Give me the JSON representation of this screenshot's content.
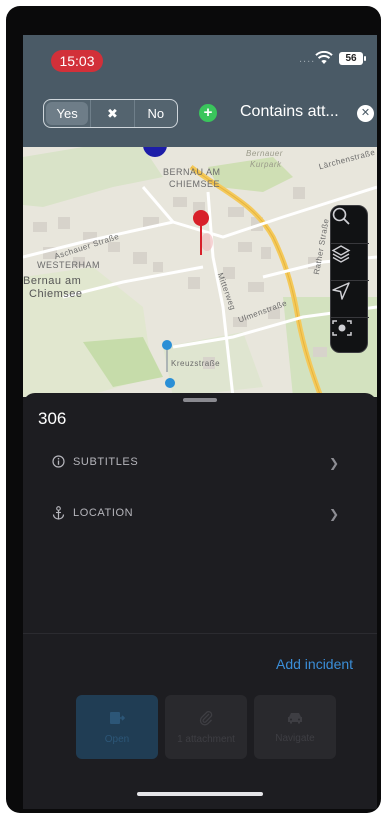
{
  "status_bar": {
    "time": "15:03",
    "signal_dots": "....",
    "battery": "56"
  },
  "filter_bar": {
    "segments": [
      "Yes",
      "✖",
      "No"
    ],
    "selected_segment": "Yes",
    "add_filter_symbol": "+",
    "filter_label": "Contains att...",
    "clear_symbol": "✕"
  },
  "map": {
    "labels": {
      "town_top": "BERNAU AM",
      "town_top_2": "CHIEMSEE",
      "kurpark": "Bernauer",
      "kurpark_2": "Kurpark",
      "larchenstrasse": "Lärchenstraße",
      "aschauer": "Aschauer Straße",
      "westerham": "WESTERHAM",
      "bernau_left": "Bernau am",
      "bernau_left_2": "Chiemsee",
      "mitterweg": "Mitterweg",
      "ulmenstrasse": "Ulmenstraße",
      "rather": "Rather Straße",
      "kreuzstrasse": "Kreuzstraße"
    },
    "controls": [
      "search-icon",
      "layers-icon",
      "navigation-arrow-icon",
      "camera-scan-icon"
    ]
  },
  "sheet": {
    "title": "306",
    "rows": [
      {
        "icon": "info-icon",
        "label": "SUBTITLES"
      },
      {
        "icon": "anchor-icon",
        "label": "LOCATION"
      }
    ],
    "chevron": "❯",
    "add_incident": "Add incident",
    "actions": [
      {
        "icon": "open-door-icon",
        "label": "Open"
      },
      {
        "icon": "paperclip-icon",
        "label": "1 attachment"
      },
      {
        "icon": "car-icon",
        "label": "Navigate"
      }
    ]
  },
  "colors": {
    "accent": "#3b8ed8",
    "toolbar": "#4a5a66",
    "pin_red": "#d8202a",
    "pin_blue": "#2a8fd6",
    "time_pill": "#d23039"
  }
}
